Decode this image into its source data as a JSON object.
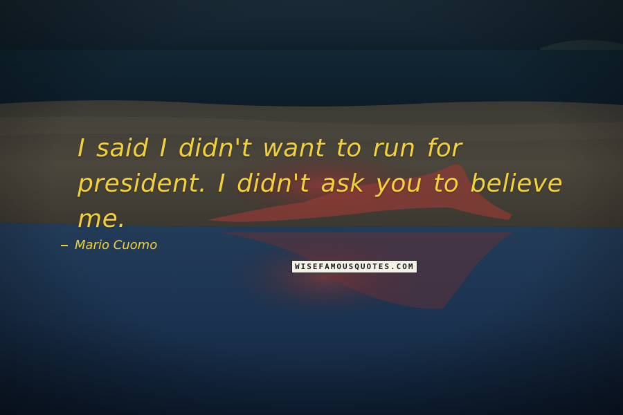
{
  "quote": {
    "text": "I said I didn't want to run for president. I didn't ask you to believe me.",
    "author": "Mario Cuomo"
  },
  "watermark": {
    "text": "WISEFAMOUSQUOTES.COM"
  },
  "colors": {
    "quote_text": "#f2d03a",
    "sea_dark": "#0e1e2a",
    "water_blue": "#1c3550"
  }
}
